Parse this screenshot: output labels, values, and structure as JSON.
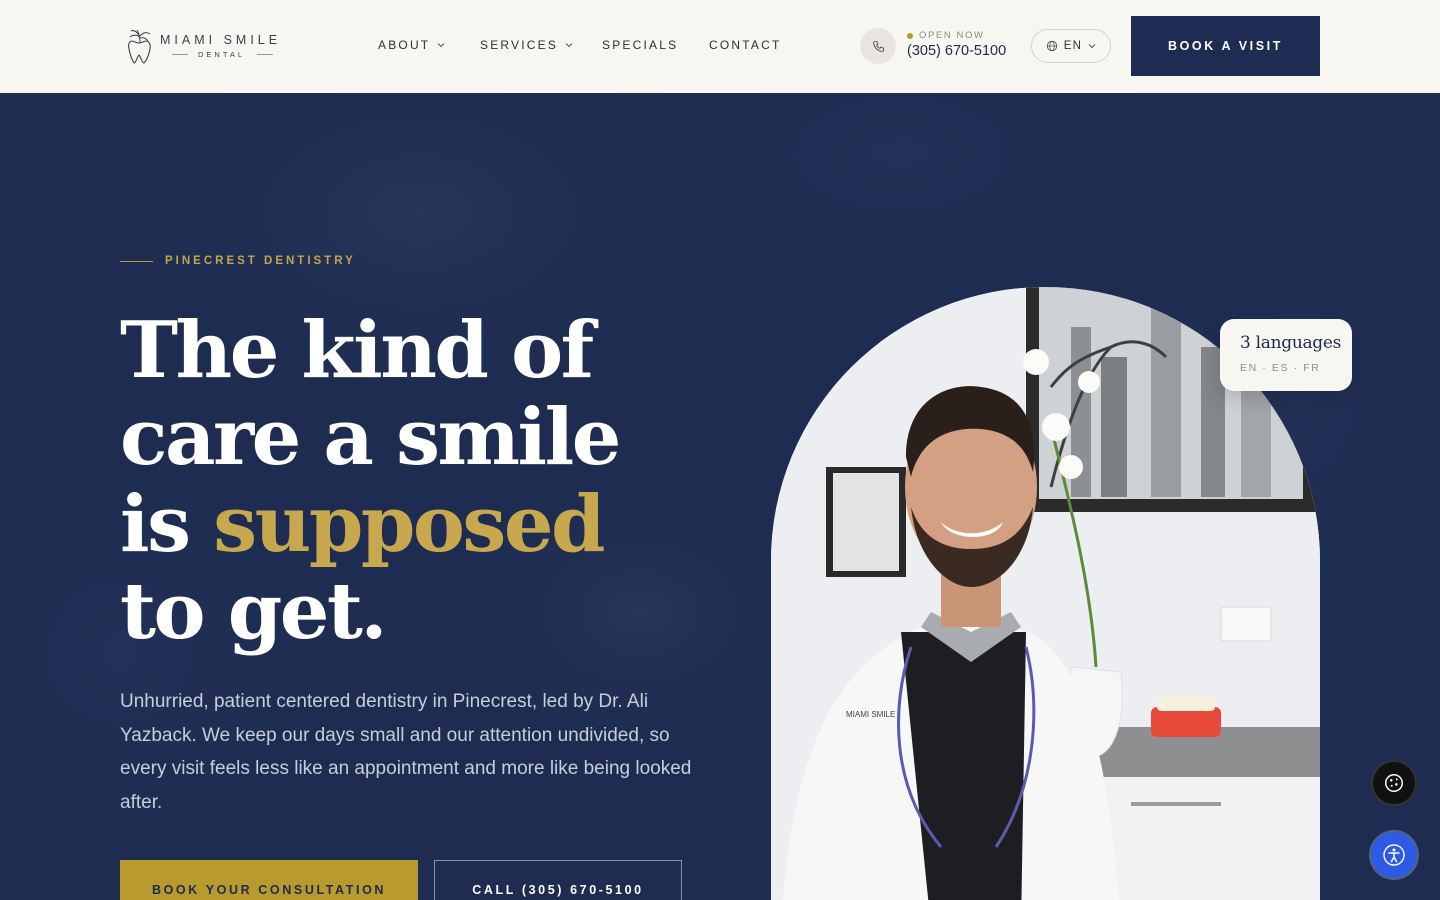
{
  "brand": {
    "name_top": "MIAMI SMILE",
    "name_bottom": "DENTAL",
    "logo_icon": "tooth-palm-icon"
  },
  "nav": {
    "items": [
      {
        "label": "ABOUT",
        "has_dropdown": true
      },
      {
        "label": "SERVICES",
        "has_dropdown": true
      },
      {
        "label": "SPECIALS",
        "has_dropdown": false
      },
      {
        "label": "CONTACT",
        "has_dropdown": false
      }
    ]
  },
  "contact": {
    "status": "OPEN NOW",
    "phone": "(305) 670-5100",
    "phone_icon": "phone-icon"
  },
  "language": {
    "current": "EN",
    "icon": "globe-icon"
  },
  "header_cta": "BOOK A VISIT",
  "hero": {
    "eyebrow": "PINECREST DENTISTRY",
    "headline": {
      "line1": "The kind of",
      "line2": "care a smile",
      "line3_prefix": "is ",
      "line3_highlight": "supposed",
      "line4": "to get."
    },
    "lead": "Unhurried, patient centered dentistry in Pinecrest, led by Dr. Ali Yazback. We keep our days small and our attention undivided, so every visit feels less like an appointment and more like being looked after.",
    "primary_cta": "BOOK YOUR CONSULTATION",
    "secondary_cta": "CALL (305) 670-5100"
  },
  "languages_card": {
    "title": "3 languages",
    "list": "EN · ES · FR"
  },
  "floating": {
    "cookie_icon": "cookie-icon",
    "accessibility_icon": "accessibility-icon"
  },
  "colors": {
    "navy": "#1d2b4f",
    "gold": "#c8a84e",
    "cream": "#f8f6f1",
    "accessibility_blue": "#2e5be6"
  }
}
